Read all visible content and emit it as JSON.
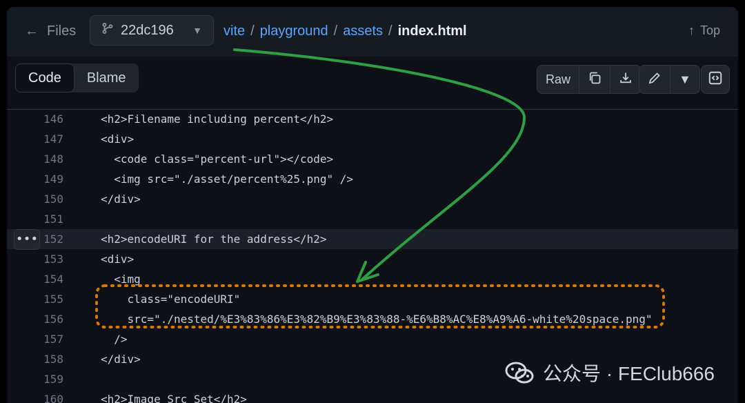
{
  "topbar": {
    "files_label": "Files",
    "branch": "22dc196",
    "breadcrumbs": {
      "a": "vite",
      "b": "playground",
      "c": "assets",
      "current": "index.html",
      "sep": "/"
    },
    "top_label": "Top"
  },
  "toolbar": {
    "tabs": [
      "Code",
      "Blame"
    ],
    "raw_label": "Raw"
  },
  "code": {
    "lines": [
      {
        "n": "146",
        "t": "<h2>Filename including percent</h2>"
      },
      {
        "n": "147",
        "t": "<div>"
      },
      {
        "n": "148",
        "t": "  <code class=\"percent-url\"></code>"
      },
      {
        "n": "149",
        "t": "  <img src=\"./asset/percent%25.png\" />"
      },
      {
        "n": "150",
        "t": "</div>"
      },
      {
        "n": "151",
        "t": ""
      },
      {
        "n": "152",
        "t": "<h2>encodeURI for the address</h2>"
      },
      {
        "n": "153",
        "t": "<div>"
      },
      {
        "n": "154",
        "t": "  <img"
      },
      {
        "n": "155",
        "t": "    class=\"encodeURI\""
      },
      {
        "n": "156",
        "t": "    src=\"./nested/%E3%83%86%E3%82%B9%E3%83%88-%E6%B8%AC%E8%A9%A6-white%20space.png\""
      },
      {
        "n": "157",
        "t": "  />"
      },
      {
        "n": "158",
        "t": "</div>"
      },
      {
        "n": "159",
        "t": ""
      },
      {
        "n": "160",
        "t": "<h2>Image Src Set</h2>"
      }
    ]
  },
  "watermark": {
    "text": "公众号 · FEClub666"
  },
  "colors": {
    "accent": "#58a6ff",
    "annotation_arrow": "#2ea043",
    "annotation_box": "#d97706"
  }
}
